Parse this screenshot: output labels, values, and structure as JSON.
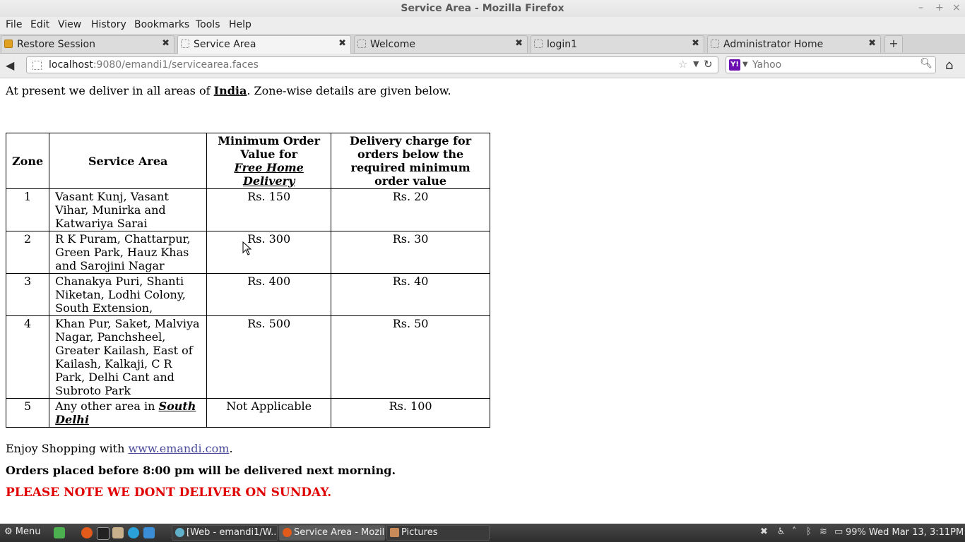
{
  "window": {
    "title": "Service Area - Mozilla Firefox",
    "controls": [
      "–",
      "+",
      "×"
    ]
  },
  "menubar": [
    "File",
    "Edit",
    "View",
    "History",
    "Bookmarks",
    "Tools",
    "Help"
  ],
  "tabs": [
    {
      "label": "Restore Session",
      "active": false
    },
    {
      "label": "Service Area",
      "active": true
    },
    {
      "label": "Welcome",
      "active": false
    },
    {
      "label": "login1",
      "active": false
    },
    {
      "label": "Administrator Home",
      "active": false
    }
  ],
  "tab_close": "✖",
  "new_tab": "+",
  "nav": {
    "url_host": "localhost",
    "url_rest": ":9080/emandi1/servicearea.faces",
    "search_placeholder": "Yahoo",
    "search_engine_badge": "Y!"
  },
  "page": {
    "intro_before": "At present we deliver in all areas of ",
    "intro_link": "India",
    "intro_after": ". Zone-wise details are given below.",
    "table": {
      "headers": {
        "zone": "Zone",
        "area": "Service Area",
        "min_line1": "Minimum Order Value for",
        "min_link": "Free Home Delivery",
        "charge": "Delivery charge for orders below the required minimum order value"
      },
      "rows": [
        {
          "zone": "1",
          "area": "Vasant Kunj, Vasant Vihar, Munirka and Katwariya Sarai",
          "min": "Rs. 150",
          "charge": "Rs. 20"
        },
        {
          "zone": "2",
          "area": "R K Puram, Chattarpur, Green Park, Hauz Khas and Sarojini Nagar",
          "min": "Rs. 300",
          "charge": "Rs. 30"
        },
        {
          "zone": "3",
          "area": "Chanakya Puri, Shanti Niketan, Lodhi Colony, South Extension,",
          "min": "Rs. 400",
          "charge": "Rs. 40"
        },
        {
          "zone": "4",
          "area": "Khan Pur, Saket, Malviya Nagar, Panchsheel, Greater Kailash, East of Kailash, Kalkaji, C R Park, Delhi Cant and Subroto Park",
          "min": "Rs. 500",
          "charge": "Rs. 50"
        },
        {
          "zone": "5",
          "area_before": "Any other area in ",
          "area_link": "South Delhi",
          "min": "Not Applicable",
          "charge": "Rs. 100"
        }
      ]
    },
    "enjoy_before": "Enjoy Shopping with ",
    "enjoy_link": "www.emandi.com",
    "enjoy_after": ".",
    "orders_note": "Orders placed before 8:00 pm will be delivered next morning.",
    "sunday_note": "PLEASE NOTE WE DONT DELIVER ON SUNDAY."
  },
  "taskbar": {
    "menu_label": "Menu",
    "tasks": [
      {
        "label": "[Web - emandi1/W...",
        "active": false
      },
      {
        "label": "Service Area - Mozil...",
        "active": true
      },
      {
        "label": "Pictures",
        "active": false
      }
    ],
    "battery": "99%",
    "clock": "Wed Mar 13,  3:11PM"
  },
  "colors": {
    "warning_red": "#e00000",
    "link_blue": "#4a4a9a",
    "taskbar_bg": "#3a3a3a"
  }
}
